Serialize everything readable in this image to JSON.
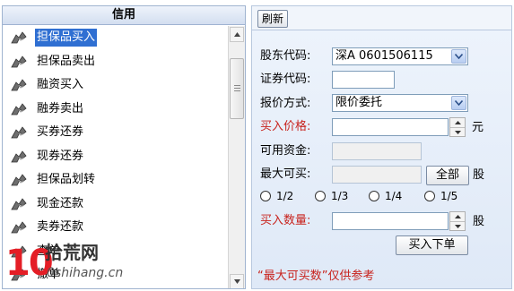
{
  "left_panel": {
    "title": "信用",
    "items": [
      {
        "label": "担保品买入",
        "selected": true
      },
      {
        "label": "担保品卖出"
      },
      {
        "label": "融资买入"
      },
      {
        "label": "融券卖出"
      },
      {
        "label": "买券还券"
      },
      {
        "label": "现券还券"
      },
      {
        "label": "担保品划转"
      },
      {
        "label": "现金还款"
      },
      {
        "label": "卖券还款"
      },
      {
        "label": "查单"
      },
      {
        "label": "撤单"
      }
    ]
  },
  "toolbar": {
    "refresh_label": "刷新"
  },
  "form": {
    "shareholder_code_label": "股东代码:",
    "shareholder_code_value": "深A 0601506115",
    "security_code_label": "证券代码:",
    "security_code_value": "",
    "quote_method_label": "报价方式:",
    "quote_method_value": "限价委托",
    "buy_price_label": "买入价格:",
    "buy_price_value": "",
    "price_unit": "元",
    "available_funds_label": "可用资金:",
    "available_funds_value": "",
    "max_buyable_label": "最大可买:",
    "max_buyable_value": "",
    "all_button_label": "全部",
    "share_unit": "股",
    "ratios": [
      "1/2",
      "1/3",
      "1/4",
      "1/5"
    ],
    "buy_quantity_label": "买入数量:",
    "buy_quantity_value": "",
    "quantity_unit": "股",
    "submit_label": "买入下单",
    "note": "“最大可买数”仅供参考"
  },
  "watermark": {
    "number": "10",
    "text": "拾荒网",
    "url": "0shihang.cn"
  },
  "colors": {
    "selected_bg": "#2f6fd2",
    "red_label": "#c8231d",
    "watermark_red": "#e41e26"
  }
}
